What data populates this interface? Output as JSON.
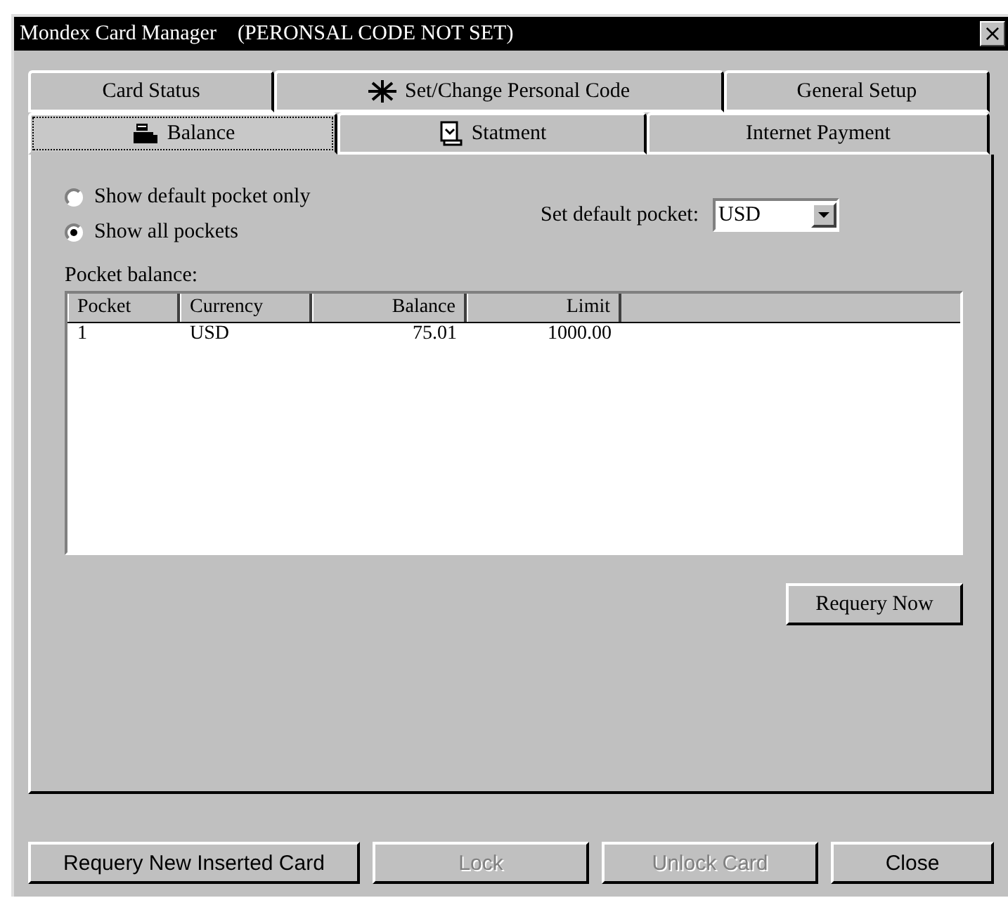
{
  "window": {
    "title": "Mondex Card Manager    (PERONSAL CODE NOT SET)",
    "close": "×"
  },
  "tab_rows": [
    [
      {
        "label": "Card Status",
        "selected": false
      },
      {
        "label": "Set/Change Personal Code",
        "selected": false
      },
      {
        "label": "General Setup",
        "selected": false
      }
    ],
    [
      {
        "label": "Balance",
        "selected": true
      },
      {
        "label": "Statment",
        "selected": false
      },
      {
        "label": "Internet Payment",
        "selected": false
      }
    ]
  ],
  "options": [
    {
      "label": "Show default pocket only",
      "selected": false
    },
    {
      "label": "Show all pockets",
      "selected": true
    }
  ],
  "default_pocket": {
    "label": "Set default pocket:",
    "value": "USD"
  },
  "table": {
    "label": "Pocket balance:",
    "columns": [
      "Pocket",
      "Currency",
      "Balance",
      "Limit"
    ],
    "rows": [
      [
        "1",
        "USD",
        "75.01",
        "1000.00"
      ]
    ]
  },
  "requery_button": "Requery Now",
  "buttons": [
    {
      "label": "Requery New Inserted Card",
      "disabled": false
    },
    {
      "label": "Lock",
      "disabled": true
    },
    {
      "label": "Unlock Card",
      "disabled": true
    },
    {
      "label": "Close",
      "disabled": false
    }
  ]
}
